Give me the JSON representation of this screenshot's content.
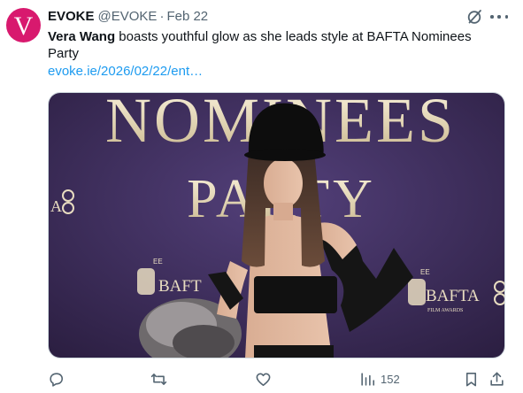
{
  "tweet": {
    "avatar_letter": "V",
    "display_name": "EVOKE",
    "handle": "@EVOKE",
    "separator": "·",
    "date": "Feb 22",
    "text_bold": "Vera Wang",
    "text_rest": " boasts youthful glow as she leads style at BAFTA Nominees Party",
    "link": "evoke.ie/2026/02/22/ent…",
    "views": "152"
  },
  "media": {
    "backdrop_line1": "NOMINEES",
    "backdrop_line2": "PARTY",
    "logo_left": "BAFT",
    "logo_right": "BAFTA",
    "logo_sub": "FILM AWARDS",
    "ee": "EE"
  },
  "colors": {
    "brand": "#d8196e",
    "link": "#1d9bf0",
    "muted": "#536471",
    "backdrop": "#3d2c55",
    "gold": "#e8dcc0"
  },
  "icons": [
    "grok-icon",
    "more-icon",
    "reply-icon",
    "repost-icon",
    "like-icon",
    "views-icon",
    "bookmark-icon",
    "share-icon"
  ]
}
